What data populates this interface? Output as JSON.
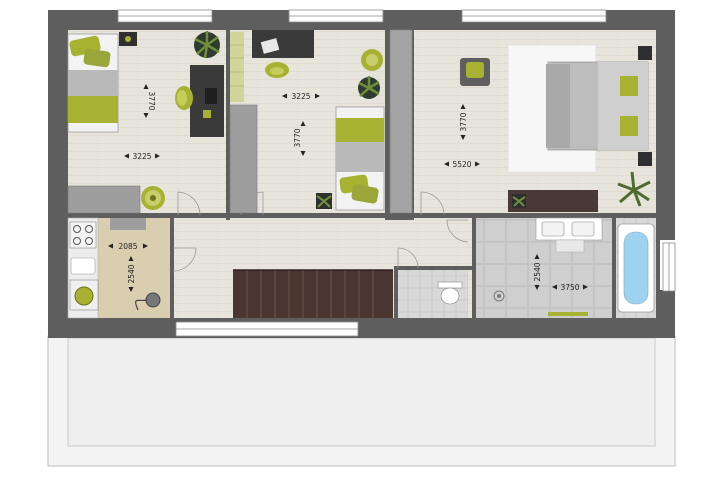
{
  "floor_plan": {
    "dimensions": [
      {
        "id": "bedroom-left-width",
        "text": "3225"
      },
      {
        "id": "bedroom-left-depth",
        "text": "3770"
      },
      {
        "id": "bedroom-mid-width",
        "text": "3225"
      },
      {
        "id": "bedroom-mid-depth",
        "text": "3770"
      },
      {
        "id": "bedroom-master-width",
        "text": "5520"
      },
      {
        "id": "bedroom-master-depth",
        "text": "3770"
      },
      {
        "id": "laundry-width",
        "text": "2085"
      },
      {
        "id": "laundry-depth",
        "text": "2540"
      },
      {
        "id": "bathroom-width",
        "text": "3750"
      },
      {
        "id": "bathroom-depth",
        "text": "2540"
      }
    ]
  },
  "colors": {
    "wall": "#5e5e5e",
    "floor_wood": "#e7e4dc",
    "floor_laundry": "#d9ceb0",
    "floor_tile": "#cfcfcf",
    "roof": "#f3f3f3",
    "stairs": "#4a3530",
    "accent_green": "#9aa53a",
    "bed_grey": "#b8b8b8",
    "furniture_dark": "#3a3a3a"
  },
  "icons": [
    "bed-icon",
    "plant-icon",
    "chair-icon",
    "desk-icon",
    "wardrobe-icon",
    "toilet-icon",
    "bathtub-icon",
    "sink-icon",
    "shower-icon",
    "stove-icon",
    "washing-machine-icon",
    "vacuum-icon",
    "stairs-icon",
    "door-icon",
    "window-icon"
  ]
}
